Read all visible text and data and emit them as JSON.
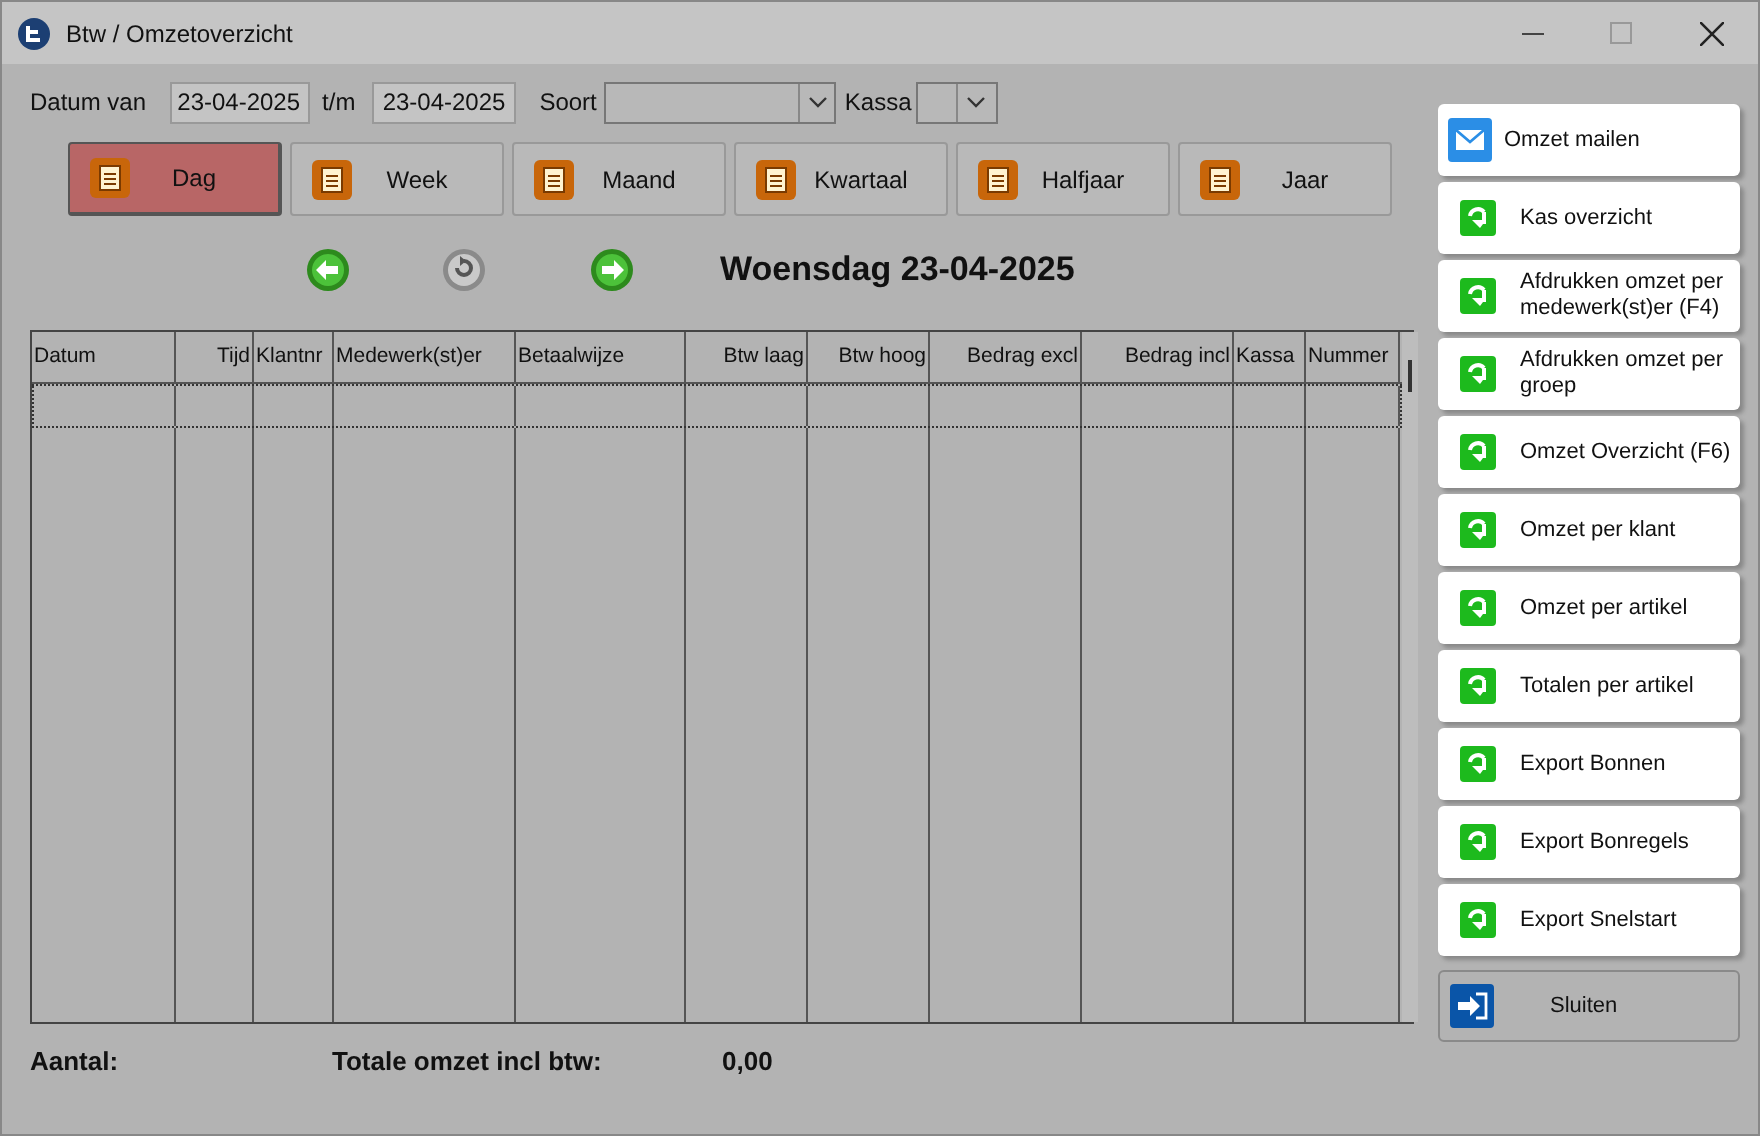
{
  "window": {
    "title": "Btw / Omzetoverzicht"
  },
  "filters": {
    "date_from_label": "Datum van",
    "date_from": "23-04-2025",
    "date_to_label": "t/m",
    "date_to": "23-04-2025",
    "soort_label": "Soort",
    "kassa_label": "Kassa"
  },
  "periods": [
    {
      "label": "Dag",
      "selected": true
    },
    {
      "label": "Week",
      "selected": false
    },
    {
      "label": "Maand",
      "selected": false
    },
    {
      "label": "Kwartaal",
      "selected": false
    },
    {
      "label": "Halfjaar",
      "selected": false
    },
    {
      "label": "Jaar",
      "selected": false
    }
  ],
  "current_date": "Woensdag 23-04-2025",
  "table": {
    "columns": [
      "Datum",
      "Tijd",
      "Klantnr",
      "Medewerk(st)er",
      "Betaalwijze",
      "Btw laag",
      "Btw hoog",
      "Bedrag excl",
      "Bedrag incl",
      "Kassa",
      "Nummer"
    ]
  },
  "footer": {
    "count_label": "Aantal:",
    "total_label": "Totale omzet incl btw:",
    "total": "0,00"
  },
  "actions": [
    {
      "label": "Omzet mailen",
      "kind": "mail"
    },
    {
      "label": "Kas overzicht",
      "kind": "report"
    },
    {
      "label": "Afdrukken omzet per medewerk(st)er (F4)",
      "kind": "report"
    },
    {
      "label": "Afdrukken omzet per groep",
      "kind": "report"
    },
    {
      "label": "Omzet Overzicht (F6)",
      "kind": "report"
    },
    {
      "label": "Omzet per klant",
      "kind": "report"
    },
    {
      "label": "Omzet per artikel",
      "kind": "report"
    },
    {
      "label": "Totalen per artikel",
      "kind": "report"
    },
    {
      "label": "Export Bonnen",
      "kind": "report"
    },
    {
      "label": "Export Bonregels",
      "kind": "report"
    },
    {
      "label": "Export Snelstart",
      "kind": "report"
    },
    {
      "label": "Sluiten",
      "kind": "close"
    }
  ]
}
